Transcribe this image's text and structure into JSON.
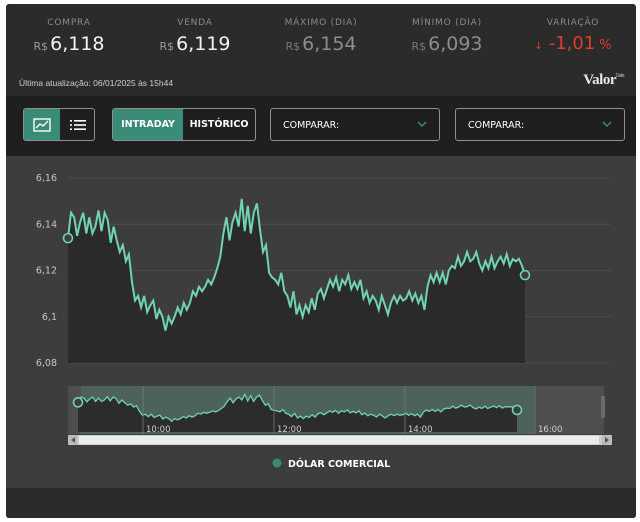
{
  "stats": [
    {
      "label": "COMPRA",
      "currency": "R$",
      "value": "6,118"
    },
    {
      "label": "VENDA",
      "currency": "R$",
      "value": "6,119"
    },
    {
      "label": "MÁXIMO (DIA)",
      "currency": "R$",
      "value": "6,154"
    },
    {
      "label": "MÍNIMO (DIA)",
      "currency": "R$",
      "value": "6,093"
    },
    {
      "label": "VARIAÇÃO",
      "arrow": "↓",
      "value": "-1,01",
      "unit": "%"
    }
  ],
  "updated": "Última atualização: 06/01/2025 às 15h44",
  "logo": {
    "text": "Valor",
    "sup": "Data"
  },
  "toolbar": {
    "view_chart_icon": "line-chart-icon",
    "view_list_icon": "list-icon",
    "tabs": [
      "INTRADAY",
      "HISTÓRICO"
    ],
    "compare1": "COMPARAR:",
    "compare2": "COMPARAR:"
  },
  "colors": {
    "accent": "#3a8b77",
    "line": "#6fd3b4",
    "negative": "#e03c31"
  },
  "chart_data": {
    "type": "area",
    "series": [
      {
        "name": "DÓLAR COMERCIAL",
        "values": [
          6.134,
          6.145,
          6.143,
          6.135,
          6.141,
          6.145,
          6.136,
          6.143,
          6.136,
          6.139,
          6.146,
          6.137,
          6.145,
          6.142,
          6.132,
          6.139,
          6.133,
          6.128,
          6.131,
          6.124,
          6.127,
          6.115,
          6.107,
          6.109,
          6.104,
          6.109,
          6.102,
          6.105,
          6.107,
          6.099,
          6.103,
          6.1,
          6.094,
          6.1,
          6.097,
          6.1,
          6.104,
          6.101,
          6.106,
          6.103,
          6.106,
          6.111,
          6.109,
          6.113,
          6.111,
          6.113,
          6.116,
          6.114,
          6.117,
          6.121,
          6.126,
          6.136,
          6.143,
          6.133,
          6.141,
          6.145,
          6.139,
          6.151,
          6.137,
          6.148,
          6.136,
          6.145,
          6.149,
          6.138,
          6.128,
          6.131,
          6.119,
          6.117,
          6.116,
          6.114,
          6.119,
          6.111,
          6.109,
          6.104,
          6.111,
          6.101,
          6.105,
          6.1,
          6.105,
          6.102,
          6.108,
          6.103,
          6.11,
          6.112,
          6.108,
          6.112,
          6.116,
          6.113,
          6.117,
          6.111,
          6.116,
          6.114,
          6.118,
          6.112,
          6.115,
          6.112,
          6.116,
          6.108,
          6.111,
          6.106,
          6.109,
          6.107,
          6.103,
          6.109,
          6.105,
          6.101,
          6.106,
          6.109,
          6.106,
          6.109,
          6.107,
          6.108,
          6.111,
          6.107,
          6.11,
          6.106,
          6.109,
          6.103,
          6.113,
          6.118,
          6.115,
          6.119,
          6.115,
          6.119,
          6.114,
          6.12,
          6.122,
          6.121,
          6.126,
          6.122,
          6.124,
          6.128,
          6.124,
          6.125,
          6.128,
          6.123,
          6.12,
          6.124,
          6.121,
          6.126,
          6.121,
          6.124,
          6.126,
          6.123,
          6.127,
          6.122,
          6.125,
          6.124,
          6.125,
          6.122,
          6.118
        ]
      }
    ],
    "y_ticks": [
      "6,16",
      "6,14",
      "6,12",
      "6,1",
      "6,08"
    ],
    "ylim": [
      6.08,
      6.16
    ],
    "navigator_x_ticks": [
      "10:00",
      "12:00",
      "14:00",
      "16:00"
    ],
    "legend": "DÓLAR COMERCIAL",
    "legend_position": "bottom-center",
    "grid": true
  }
}
